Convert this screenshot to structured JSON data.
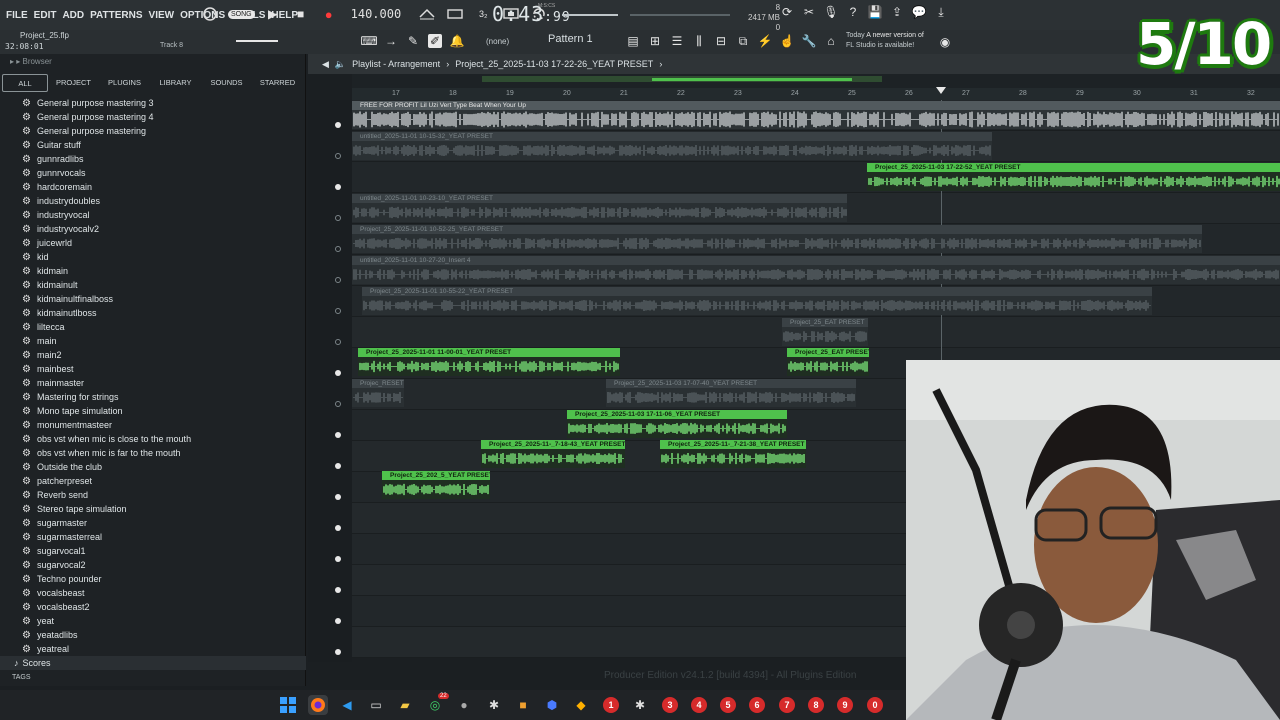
{
  "menu": [
    "FILE",
    "EDIT",
    "ADD",
    "PATTERNS",
    "VIEW",
    "OPTIONS",
    "TOOLS",
    "HELP"
  ],
  "transport": {
    "mode": "SONG",
    "tempo": "140.000",
    "time_main": "0:43",
    "time_sub": ":99",
    "time_unit": "M:S:CS"
  },
  "status": {
    "cpu_top": "8",
    "memory": "2417 MB",
    "cpu_bottom": "0"
  },
  "project": {
    "file": "Project_25.flp",
    "elapsed": "32:08:01",
    "track_hint": "Track 8"
  },
  "toolbar": {
    "snap": "(none)",
    "pattern": "Pattern 1"
  },
  "news": {
    "when": "Today",
    "message_line1": "A newer version of",
    "message_line2": "FL Studio is available!"
  },
  "browser": {
    "title": "Browser",
    "tabs": [
      "ALL",
      "PROJECT",
      "PLUGINS",
      "LIBRARY",
      "SOUNDS",
      "STARRED"
    ],
    "items": [
      "General purpose mastering 3",
      "General purpose mastering 4",
      "General purpose mastering",
      "Guitar stuff",
      "gunnradlibs",
      "gunnrvocals",
      "hardcoremain",
      "industrydoubles",
      "industryvocal",
      "industryvocalv2",
      "juicewrld",
      "kid",
      "kidmain",
      "kidmainult",
      "kidmainultfinalboss",
      "kidmainutlboss",
      "liltecca",
      "main",
      "main2",
      "mainbest",
      "mainmaster",
      "Mastering for strings",
      "Mono tape simulation",
      "monumentmasteer",
      "obs vst when mic is close to the mouth",
      "obs vst when mic is far to the mouth",
      "Outside the club",
      "patcherpreset",
      "Reverb send",
      "Stereo tape simulation",
      "sugarmaster",
      "sugarmasterreal",
      "sugarvocal1",
      "sugarvocal2",
      "Techno pounder",
      "vocalsbeast",
      "vocalsbeast2",
      "yeat",
      "yeatadlibs",
      "yeatreal"
    ],
    "scores_label": "Scores",
    "tags_label": "TAGS"
  },
  "playlist": {
    "title": "Playlist - Arrangement",
    "breadcrumb": "Project_25_2025-11-03 17-22-26_YEAT PRESET",
    "ruler": [
      "17",
      "18",
      "19",
      "20",
      "21",
      "22",
      "23",
      "24",
      "25",
      "26",
      "27",
      "28",
      "29",
      "30",
      "31",
      "32"
    ],
    "clips": [
      "FREE FOR PROFIT Lil Uzi Vert Type Beat When Your Up",
      "untitled_2025-11-01 10-15-32_YEAT PRESET",
      "Project_25_2025-11-03 17-22-52_YEAT PRESET",
      "untitled_2025-11-01 10-23-10_YEAT PRESET",
      "Project_25_2025-11-01 10-52-25_YEAT PRESET",
      "untitled_2025-11-01 10-27-20_Insert 4",
      "Project_25_2025-11-01 10-55-22_YEAT PRESET",
      "Project_25_EAT PRESET",
      "Project_25_2025-11-01 11-00-01_YEAT PRESET",
      "Project_25_EAT PRESET",
      "Projec_RESET",
      "Project_25_2025-11-03 17-07-40_YEAT PRESET",
      "Project_25_2025-11-03 17-11-06_YEAT PRESET",
      "Project_25_2025-11-_7-18-43_YEAT PRESET",
      "Project_25_2025-11-_7-21-38_YEAT PRESET",
      "Project_25_202_5_YEAT PRESET"
    ],
    "edition": "Producer Edition v24.1.2 [build 4394] - All Plugins Edition"
  },
  "overlay": {
    "score": "5/10"
  },
  "taskbar": {
    "numbers": [
      "1",
      "3",
      "4",
      "5",
      "6",
      "7",
      "8",
      "9",
      "0"
    ],
    "badge": "22"
  }
}
